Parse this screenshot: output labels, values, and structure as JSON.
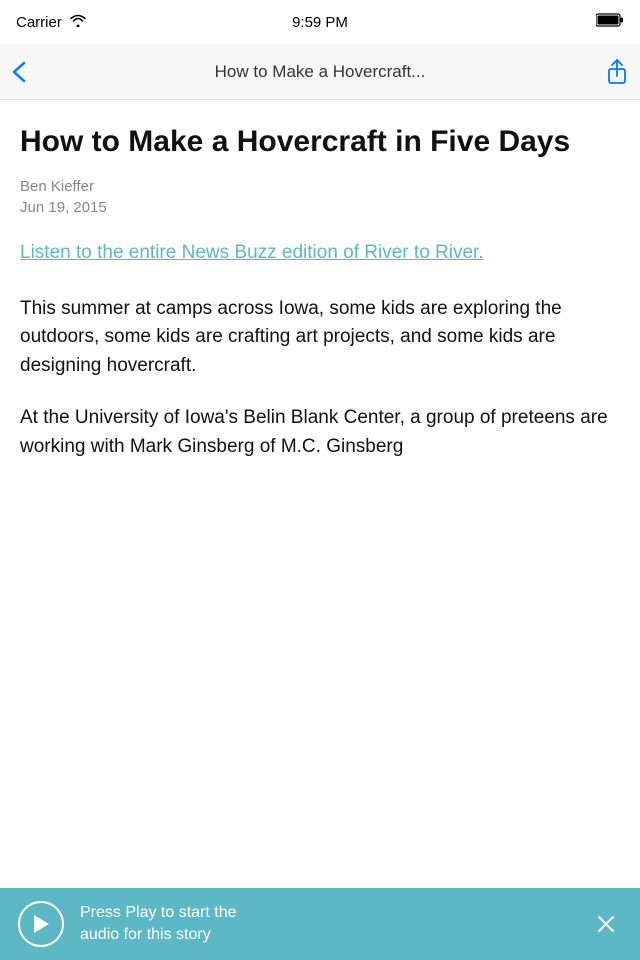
{
  "status_bar": {
    "carrier": "Carrier",
    "time": "9:59 PM"
  },
  "nav": {
    "back_label": "<",
    "title": "How to Make a Hovercraft...",
    "share_label": "share"
  },
  "article": {
    "title": "How to Make a Hovercraft in Five Days",
    "author": "Ben Kieffer",
    "date": "Jun 19, 2015",
    "link_text": "Listen to the entire News Buzz edition of River to River.",
    "body_paragraph_1": "This summer at camps across Iowa, some kids are exploring the outdoors, some kids are crafting art projects, and some kids are designing hovercraft.",
    "body_paragraph_2": "At the University of Iowa's Belin Blank Center, a group of preteens are working with Mark Ginsberg of M.C. Ginsberg"
  },
  "audio_bar": {
    "play_label": "▶",
    "message_line1": "Press Play to start the",
    "message_line2": "audio for this story",
    "close_label": "✕"
  }
}
